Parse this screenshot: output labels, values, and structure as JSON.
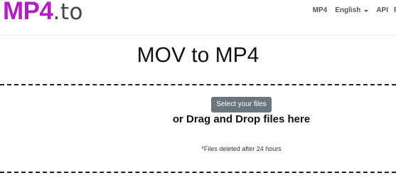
{
  "header": {
    "logo_main": "MP4",
    "logo_suffix": ".to",
    "nav": {
      "mp4": "MP4",
      "language": "English",
      "api": "API",
      "cut_off": "F"
    }
  },
  "main": {
    "title": "MOV to MP4",
    "select_button": "Select your files",
    "drag_text": "or Drag and Drop files here",
    "note": "*Files deleted after 24 hours"
  },
  "colors": {
    "brand": "#b21fc0",
    "button": "#6c757d"
  }
}
